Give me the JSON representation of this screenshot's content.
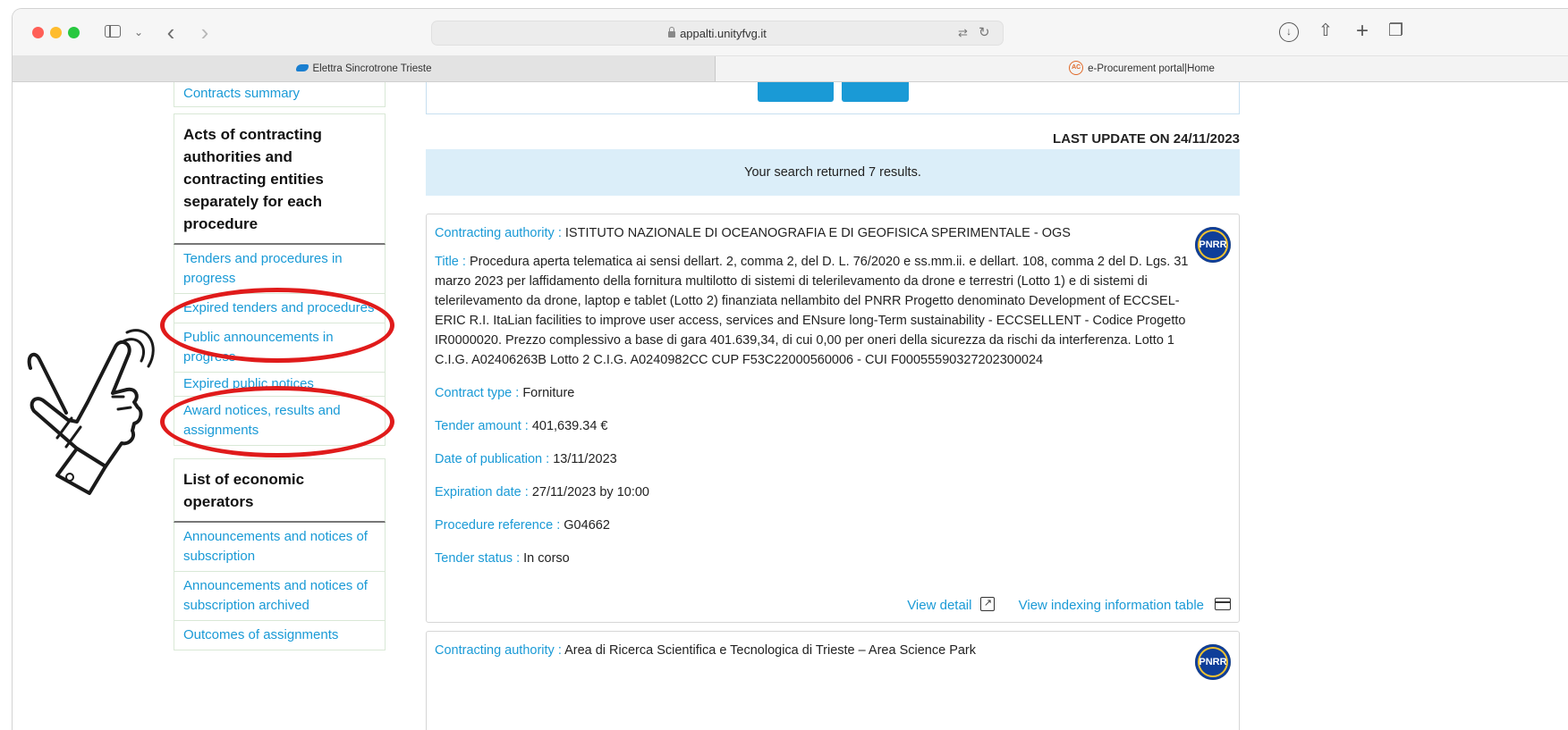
{
  "browser": {
    "url": "appalti.unityfvg.it",
    "tabs": [
      {
        "label": "Elettra Sincrotrone Trieste"
      },
      {
        "label": "e-Procurement portal|Home"
      }
    ]
  },
  "sidebar": {
    "top_link": "Contracts summary",
    "section1_title": "Acts of contracting authorities and contracting entities separately for each procedure",
    "section1_items": [
      "Tenders and procedures in progress",
      "Expired tenders and procedures",
      "Public announcements in progress",
      "Expired public notices",
      "Award notices, results and assignments"
    ],
    "section2_title": "List of economic operators",
    "section2_items": [
      "Announcements and notices of subscription",
      "Announcements and notices of subscription archived",
      "Outcomes of assignments"
    ]
  },
  "main": {
    "last_update": "LAST UPDATE ON 24/11/2023",
    "results_text": "Your search returned 7 results.",
    "labels": {
      "authority": "Contracting authority : ",
      "title": "Title : ",
      "contract_type": "Contract type : ",
      "amount": "Tender amount : ",
      "publication": "Date of publication : ",
      "expiration": "Expiration date : ",
      "reference": "Procedure reference : ",
      "status": "Tender status : "
    },
    "badge": "PNRR",
    "card1": {
      "authority": "ISTITUTO NAZIONALE DI OCEANOGRAFIA E DI GEOFISICA SPERIMENTALE - OGS",
      "title": "Procedura aperta telematica ai sensi dellart. 2, comma 2, del D. L. 76/2020 e ss.mm.ii. e dellart. 108, comma 2 del D. Lgs. 31 marzo 2023 per laffidamento della fornitura multilotto di sistemi di telerilevamento da drone e terrestri (Lotto 1) e di sistemi di telerilevamento da drone, laptop e tablet (Lotto 2) finanziata nellambito del PNRR Progetto denominato Development of ECCSEL-ERIC R.I. ItaLian facilities to improve user access, services and ENsure long-Term sustainability - ECCSELLENT - Codice Progetto IR0000020. Prezzo complessivo a base di gara 401.639,34, di cui 0,00 per oneri della sicurezza da rischi da interferenza. Lotto 1 C.I.G. A02406263B Lotto 2 C.I.G. A0240982CC CUP F53C22000560006 - CUI F00055590327202300024",
      "contract_type": "Forniture",
      "amount": "401,639.34 €",
      "publication": "13/11/2023",
      "expiration": "27/11/2023 by 10:00",
      "reference": "G04662",
      "status": "In corso",
      "view_detail": "View detail",
      "view_table": "View indexing information table"
    },
    "card2": {
      "authority": "Area di Ricerca Scientifica e Tecnologica di Trieste – Area Science Park"
    }
  },
  "colors": {
    "link": "#1a9ad6",
    "banner": "#dbeef9",
    "annotation": "#e01b1b"
  }
}
